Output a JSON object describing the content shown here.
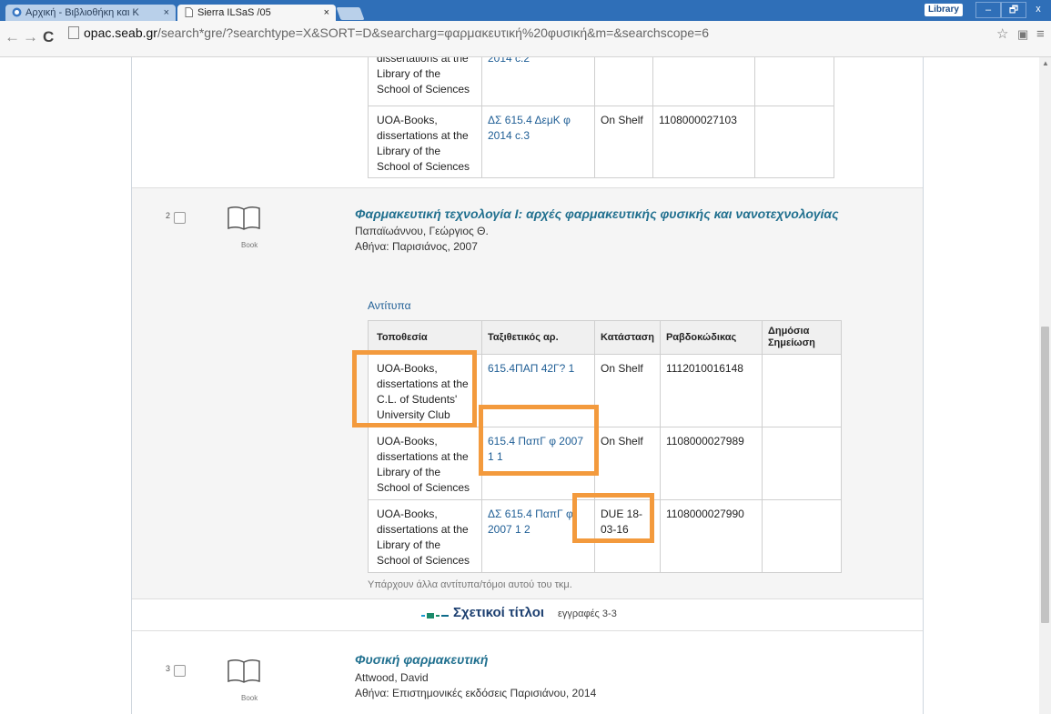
{
  "browser": {
    "tabs": [
      {
        "title": "Αρχική - Βιβλιοθήκη και Κ",
        "close": "×"
      },
      {
        "title": "Sierra ILSaS /05",
        "close": "×"
      }
    ],
    "profile": "Library",
    "window_buttons": {
      "minimize": "–",
      "maximize": "🗗",
      "close": "x"
    },
    "nav": {
      "back": "←",
      "forward": "→",
      "reload": "C"
    },
    "url_host": "opac.seab.gr",
    "url_rest": "/search*gre/?searchtype=X&SORT=D&searcharg=φαρμακευτική%20φυσική&m=&searchscope=6",
    "icons": {
      "star": "☆",
      "extension": "▣",
      "menu": "≡"
    }
  },
  "record1_tail": {
    "rows": [
      {
        "location": "dissertations at the Library of the School of Sciences",
        "call": "2014 c.2",
        "status": "",
        "barcode": "",
        "note": ""
      },
      {
        "location": "UOA-Books, dissertations at the Library of the School of Sciences",
        "call": "ΔΣ 615.4 ΔεμΚ φ 2014 c.3",
        "status": "On Shelf",
        "barcode": "1108000027103",
        "note": ""
      }
    ]
  },
  "record2": {
    "number": "2",
    "type_label": "Book",
    "title": "Φαρμακευτική τεχνολογία Ι: αρχές φαρμακευτικής φυσικής και νανοτεχνολογίας",
    "author": "Παπαϊωάννου, Γεώργιος Θ.",
    "imprint": "Αθήνα: Παρισιάνος, 2007",
    "copies_heading": "Αντίτυπα",
    "headers": [
      "Τοποθεσία",
      "Ταξιθετικός αρ.",
      "Κατάσταση",
      "Ραβδοκώδικας",
      "Δημόσια Σημείωση"
    ],
    "rows": [
      {
        "location": "UOA-Books, dissertations at the C.L. of Students' University Club",
        "call": "615.4ΠΑΠ 42Γ? 1",
        "status": "On Shelf",
        "barcode": "1112010016148",
        "note": ""
      },
      {
        "location": "UOA-Books, dissertations at the Library of the School of Sciences",
        "call": "615.4 ΠαπΓ φ 2007 1 1",
        "status": "On Shelf",
        "barcode": "1108000027989",
        "note": ""
      },
      {
        "location": "UOA-Books, dissertations at the Library of the School of Sciences",
        "call": "ΔΣ 615.4 ΠαπΓ φ 2007 1 2",
        "status": "DUE 18-03-16",
        "barcode": "1108000027990",
        "note": ""
      }
    ],
    "more_note": "Υπάρχουν άλλα αντίτυπα/τόμοι αυτού του τκμ."
  },
  "related": {
    "label": "Σχετικοί τίτλοι",
    "count": "εγγραφές 3-3"
  },
  "record3": {
    "number": "3",
    "type_label": "Book",
    "title": "Φυσική φαρμακευτική",
    "author": "Attwood, David",
    "imprint": "Αθήνα: Επιστημονικές εκδόσεις Παρισιάνου, 2014"
  },
  "colors": {
    "highlight": "#f39a3d",
    "link": "#1f5e95",
    "title": "#21708f",
    "chrome": "#2f6fb8"
  }
}
